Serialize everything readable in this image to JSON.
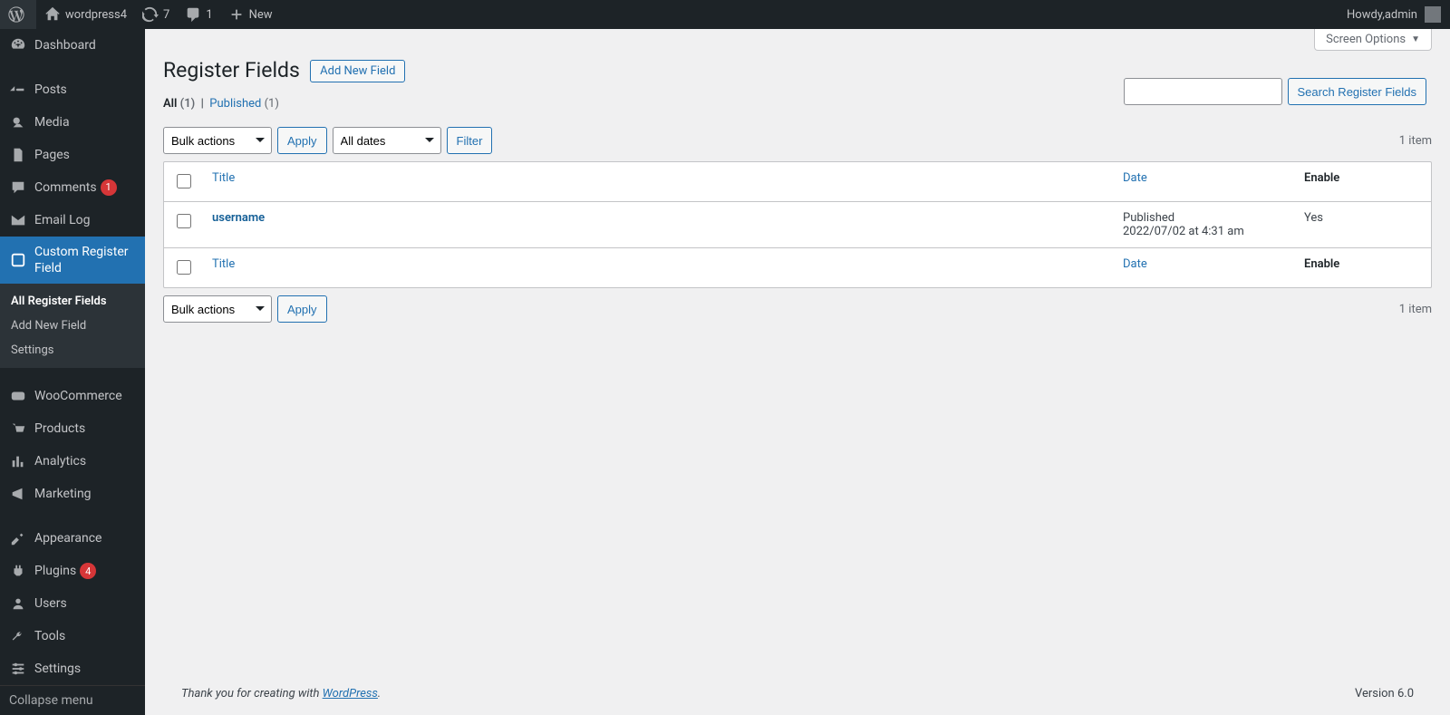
{
  "adminbar": {
    "site_name": "wordpress4",
    "updates": "7",
    "comments": "1",
    "new_label": "New",
    "howdy_prefix": "Howdy, ",
    "user": "admin"
  },
  "sidebar": {
    "items": [
      {
        "key": "dashboard",
        "label": "Dashboard"
      },
      {
        "key": "posts",
        "label": "Posts"
      },
      {
        "key": "media",
        "label": "Media"
      },
      {
        "key": "pages",
        "label": "Pages"
      },
      {
        "key": "comments",
        "label": "Comments",
        "badge": "1"
      },
      {
        "key": "email-log",
        "label": "Email Log"
      },
      {
        "key": "crf",
        "label": "Custom Register Field",
        "current": true
      },
      {
        "key": "woocommerce",
        "label": "WooCommerce"
      },
      {
        "key": "products",
        "label": "Products"
      },
      {
        "key": "analytics",
        "label": "Analytics"
      },
      {
        "key": "marketing",
        "label": "Marketing"
      },
      {
        "key": "appearance",
        "label": "Appearance"
      },
      {
        "key": "plugins",
        "label": "Plugins",
        "badge": "4"
      },
      {
        "key": "users",
        "label": "Users"
      },
      {
        "key": "tools",
        "label": "Tools"
      },
      {
        "key": "settings",
        "label": "Settings"
      }
    ],
    "submenu": [
      {
        "label": "All Register Fields",
        "current": true
      },
      {
        "label": "Add New Field"
      },
      {
        "label": "Settings"
      }
    ],
    "collapse_label": "Collapse menu"
  },
  "screen_options": "Screen Options",
  "page": {
    "title": "Register Fields",
    "add_new": "Add New Field",
    "filters": {
      "all_label": "All",
      "all_count": "(1)",
      "published_label": "Published",
      "published_count": "(1)",
      "bulk_actions": "Bulk actions",
      "apply": "Apply",
      "all_dates": "All dates",
      "filter": "Filter",
      "count_label": "1 item",
      "search_button": "Search Register Fields"
    },
    "columns": {
      "title": "Title",
      "date": "Date",
      "enable": "Enable"
    },
    "rows": [
      {
        "title": "username",
        "date_status": "Published",
        "date_value": "2022/07/02 at 4:31 am",
        "enable": "Yes"
      }
    ]
  },
  "footer": {
    "thank_you_pre": "Thank you for creating with ",
    "wordpress": "WordPress",
    "period": ".",
    "version": "Version 6.0"
  }
}
